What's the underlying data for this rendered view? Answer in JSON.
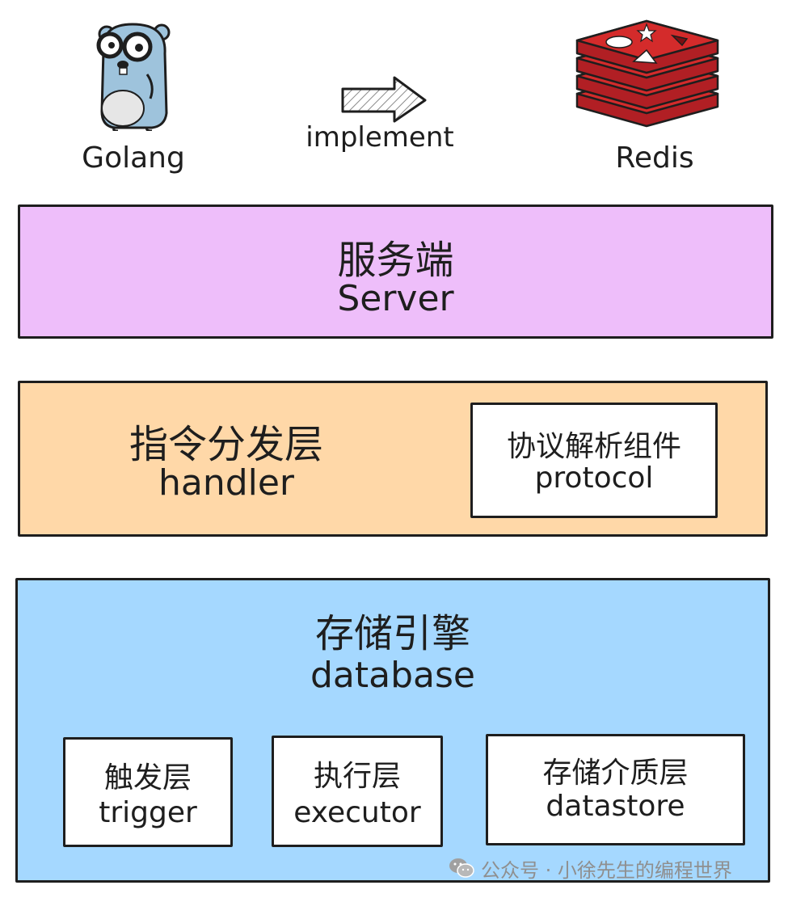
{
  "header": {
    "left_label": "Golang",
    "arrow_label": "implement",
    "right_label": "Redis",
    "left_icon": "gopher-icon",
    "right_icon": "redis-logo-icon",
    "arrow_icon": "right-arrow-icon"
  },
  "layers": {
    "server": {
      "title_zh": "服务端",
      "title_en": "Server",
      "color": "#eebefa"
    },
    "handler": {
      "title_zh": "指令分发层",
      "title_en": "handler",
      "color": "#ffd8a8",
      "component": {
        "title_zh": "协议解析组件",
        "title_en": "protocol"
      }
    },
    "database": {
      "title_zh": "存储引擎",
      "title_en": "database",
      "color": "#a5d8ff",
      "components": [
        {
          "title_zh": "触发层",
          "title_en": "trigger"
        },
        {
          "title_zh": "执行层",
          "title_en": "executor"
        },
        {
          "title_zh": "存储介质层",
          "title_en": "datastore"
        }
      ]
    }
  },
  "watermark": {
    "text": "公众号 · 小徐先生的编程世界",
    "icon": "wechat-icon"
  }
}
